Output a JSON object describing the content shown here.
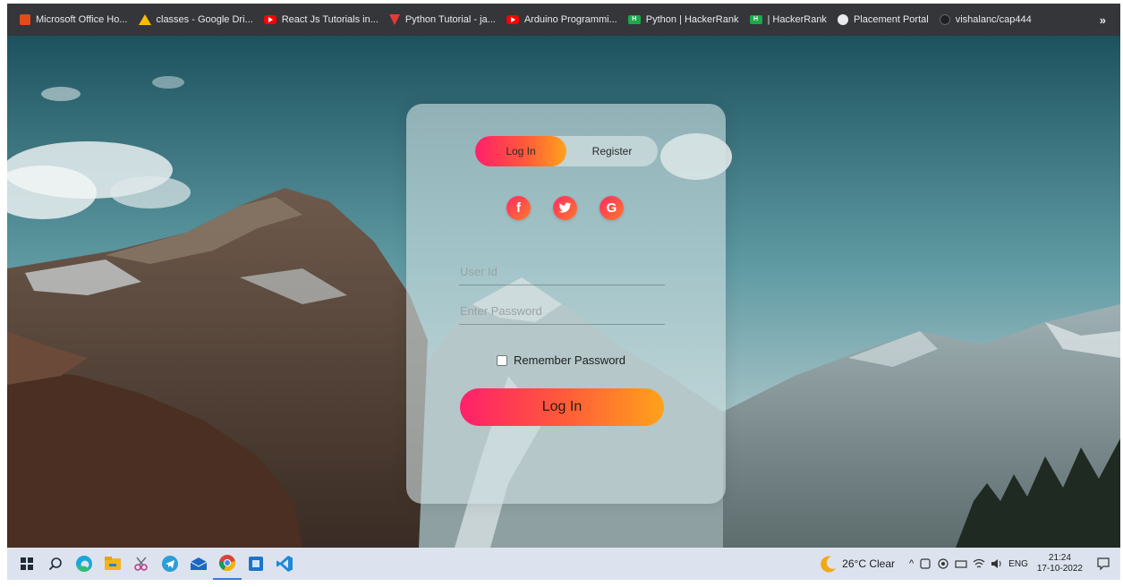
{
  "bookmarks": [
    {
      "label": "Microsoft Office Ho...",
      "icon": "office-icon"
    },
    {
      "label": "classes - Google Dri...",
      "icon": "google-drive-icon"
    },
    {
      "label": "React Js Tutorials in...",
      "icon": "youtube-icon"
    },
    {
      "label": "Python Tutorial - ja...",
      "icon": "javatpoint-icon"
    },
    {
      "label": "Arduino Programmi...",
      "icon": "youtube-icon"
    },
    {
      "label": "Python | HackerRank",
      "icon": "hackerrank-icon"
    },
    {
      "label": "| HackerRank",
      "icon": "hackerrank-icon"
    },
    {
      "label": "Placement Portal",
      "icon": "globe-icon"
    },
    {
      "label": "vishalanc/cap444",
      "icon": "github-icon"
    }
  ],
  "bookmarks_more": "»",
  "login_card": {
    "tab_login": "Log In",
    "tab_register": "Register",
    "active_tab": "login",
    "social": {
      "facebook": "f",
      "twitter": "t",
      "google": "G"
    },
    "user_id_placeholder": "User Id",
    "password_placeholder": "Enter Password",
    "remember_label": "Remember Password",
    "submit_label": "Log In"
  },
  "taskbar": {
    "apps": [
      "start-icon",
      "search-icon",
      "edge-icon",
      "file-explorer-icon",
      "snip-icon",
      "telegram-icon",
      "mail-icon",
      "chrome-icon",
      "notepad-icon",
      "vscode-icon"
    ],
    "weather": "26°C  Clear",
    "language": "ENG",
    "time": "21:24",
    "date": "17-10-2022"
  },
  "colors": {
    "accent_gradient_start": "#ff1f6b",
    "accent_gradient_end": "#ffa21a",
    "taskbar_bg": "#dde3ee",
    "bookmarks_bg": "#35363a"
  }
}
